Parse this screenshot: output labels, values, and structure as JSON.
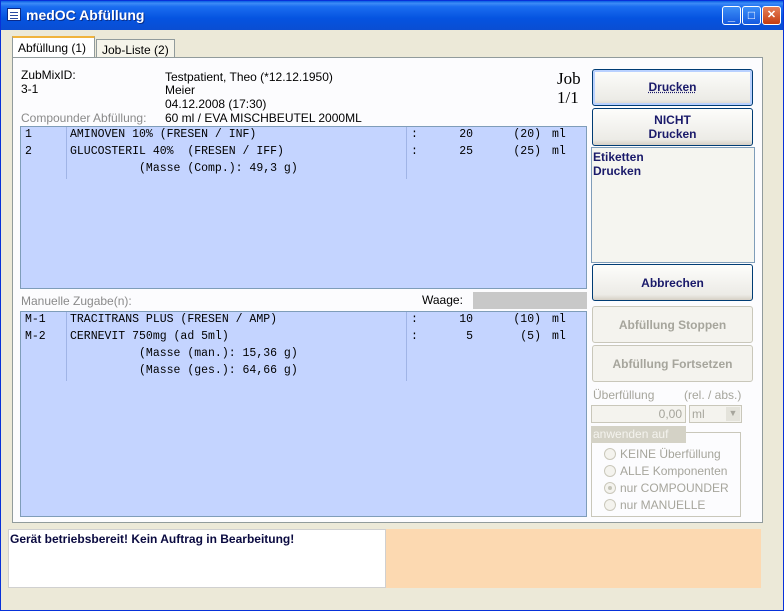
{
  "window": {
    "title": "medOC Abfüllung",
    "minimize": "_",
    "maximize": "□",
    "close": "✕"
  },
  "tabs": [
    {
      "label": "Abfüllung (1)"
    },
    {
      "label": "Job-Liste (2)"
    }
  ],
  "job": {
    "zubmix_label": "ZubMixID:",
    "zubmix_value": "3-1",
    "patient": "Testpatient, Theo (*12.12.1950)",
    "doctor": "Meier",
    "datetime": "04.12.2008 (17:30)",
    "compounder_label": "Compounder Abfüllung:",
    "compounder_value": "60 ml / EVA MISCHBEUTEL 2000ML",
    "job_label": "Job",
    "job_count": "1/1"
  },
  "compounder_list": [
    {
      "pos": "1",
      "name": "AMINOVEN 10% (FRESEN / INF)",
      "sep": ":",
      "amount": "20",
      "target": "(20)",
      "unit": "ml"
    },
    {
      "pos": "2",
      "name": "GLUCOSTERIL 40%  (FRESEN / IFF)",
      "sep": ":",
      "amount": "25",
      "target": "(25)",
      "unit": "ml"
    },
    {
      "pos": "",
      "name": "          (Masse (Comp.): 49,3 g)",
      "sep": "",
      "amount": "",
      "target": "",
      "unit": ""
    }
  ],
  "manual": {
    "label": "Manuelle Zugabe(n):",
    "waage_label": "Waage:",
    "rows": [
      {
        "pos": "M-1",
        "name": "TRACITRANS PLUS (FRESEN / AMP)",
        "sep": ":",
        "amount": "10",
        "target": "(10)",
        "unit": "ml"
      },
      {
        "pos": "M-2",
        "name": "CERNEVIT 750mg (ad 5ml)",
        "sep": ":",
        "amount": "5",
        "target": "(5)",
        "unit": "ml"
      },
      {
        "pos": "",
        "name": "          (Masse (man.): 15,36 g)",
        "sep": "",
        "amount": "",
        "target": "",
        "unit": ""
      },
      {
        "pos": "",
        "name": "          (Masse (ges.): 64,66 g)",
        "sep": "",
        "amount": "",
        "target": "",
        "unit": ""
      }
    ]
  },
  "buttons": {
    "drucken": "Drucken",
    "nicht_drucken_1": "NICHT",
    "nicht_drucken_2": "Drucken",
    "etiketten_1": "Etiketten",
    "etiketten_2": "Drucken",
    "abbrechen": "Abbrechen",
    "stoppen": "Abfüllung Stoppen",
    "fortsetzen": "Abfüllung Fortsetzen"
  },
  "overfill": {
    "label": "Überfüllung",
    "mode_label": "(rel. / abs.)",
    "value": "0,00",
    "unit": "ml",
    "group_label": "anwenden auf",
    "options": [
      "KEINE Überfüllung",
      "ALLE Komponenten",
      "nur COMPOUNDER",
      "nur MANUELLE"
    ],
    "selected": "nur COMPOUNDER"
  },
  "status": {
    "message": "Gerät betriebsbereit! Kein Auftrag in Bearbeitung!"
  },
  "colors": {
    "list_bg": "#c4d4ff",
    "status_right_bg": "#fcd9b1",
    "title_bar": "#0553e0"
  }
}
